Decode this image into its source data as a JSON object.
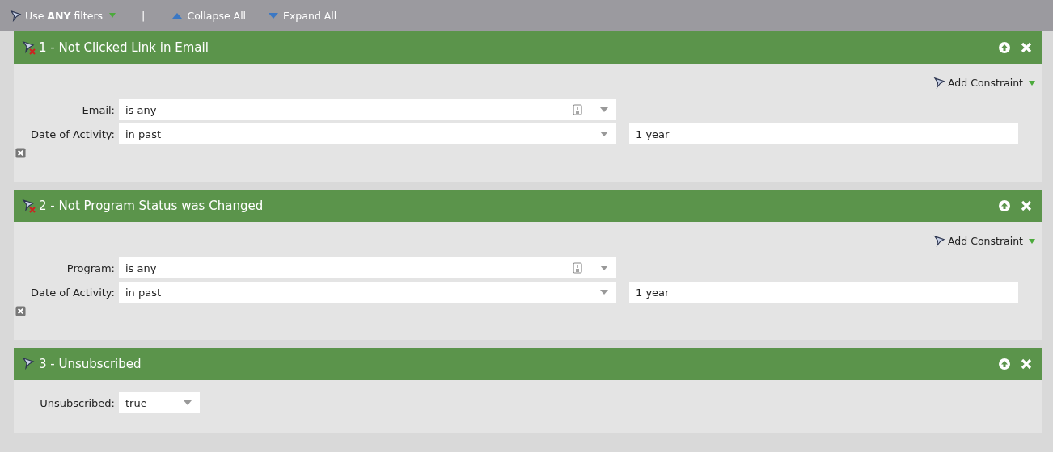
{
  "toolbar": {
    "filter_logic": "Use **ANY** filters",
    "collapse": "Collapse All",
    "expand": "Expand All",
    "separator": "|"
  },
  "filters": [
    {
      "title": "1 - Not Clicked Link in Email",
      "negated": true,
      "add_constraint": "Add Constraint",
      "removable": true,
      "rows": [
        {
          "label": "Email:",
          "kind": "picker",
          "value": "is any"
        },
        {
          "label": "Date of Activity:",
          "kind": "select",
          "value": "in past",
          "extra": "1 year"
        }
      ]
    },
    {
      "title": "2 - Not Program Status was Changed",
      "negated": true,
      "add_constraint": "Add Constraint",
      "removable": true,
      "rows": [
        {
          "label": "Program:",
          "kind": "picker",
          "value": "is any"
        },
        {
          "label": "Date of Activity:",
          "kind": "select",
          "value": "in past",
          "extra": "1 year"
        }
      ]
    },
    {
      "title": "3 - Unsubscribed",
      "negated": false,
      "removable": false,
      "rows": [
        {
          "label": "Unsubscribed:",
          "kind": "short",
          "value": "true"
        }
      ]
    }
  ]
}
